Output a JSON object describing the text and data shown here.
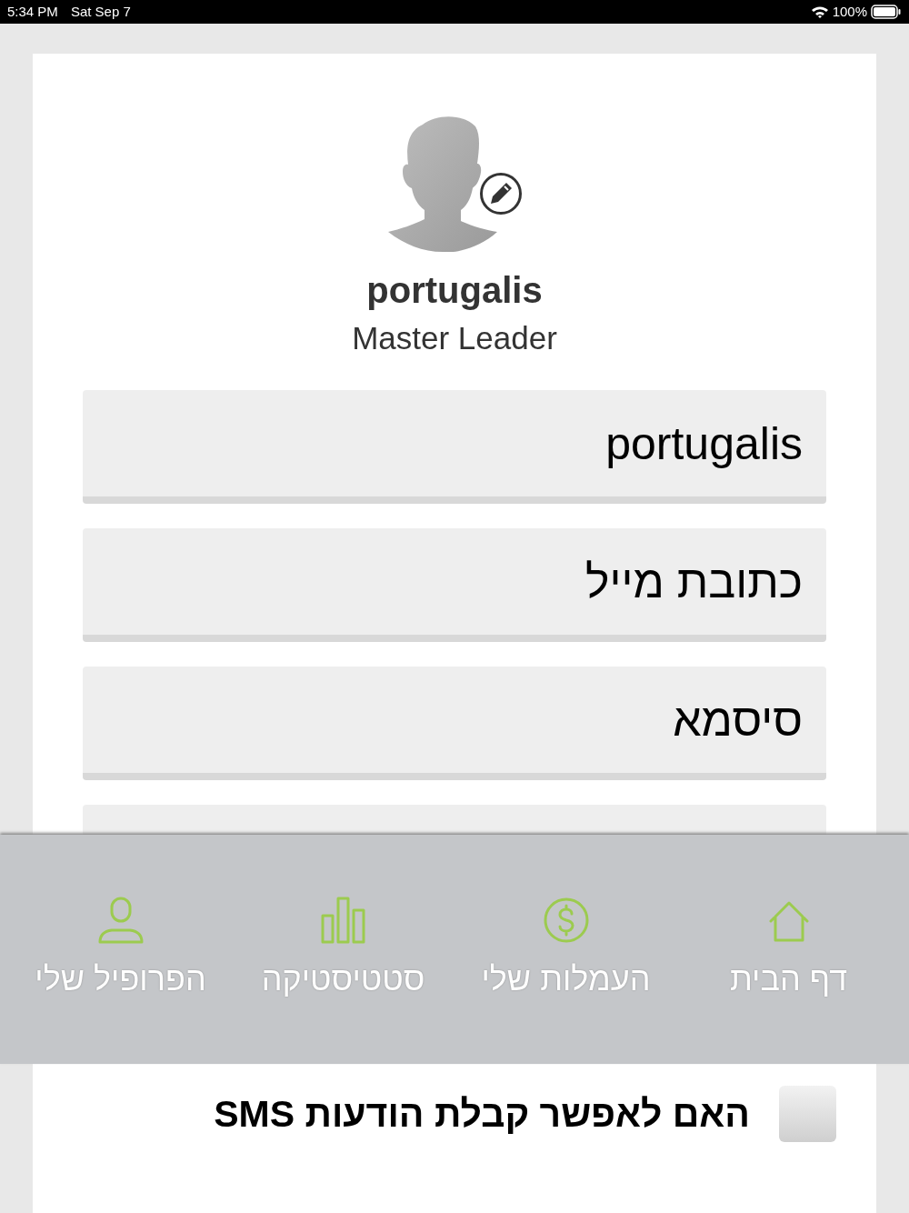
{
  "status_bar": {
    "time": "5:34 PM",
    "date": "Sat Sep 7",
    "battery": "100%"
  },
  "profile": {
    "name": "portugalis",
    "role": "Master Leader"
  },
  "fields": [
    {
      "value": "portugalis"
    },
    {
      "placeholder": "כתובת מייל"
    },
    {
      "placeholder": "סיסמא"
    }
  ],
  "nav": [
    {
      "kind": "home",
      "label": "דף הבית"
    },
    {
      "kind": "dollar",
      "label": "העמלות שלי"
    },
    {
      "kind": "chart",
      "label": "סטטיסטיקה"
    },
    {
      "kind": "user",
      "label": "הפרופיל שלי"
    }
  ],
  "sms_option": {
    "label": "האם לאפשר קבלת הודעות SMS",
    "checked": false
  }
}
